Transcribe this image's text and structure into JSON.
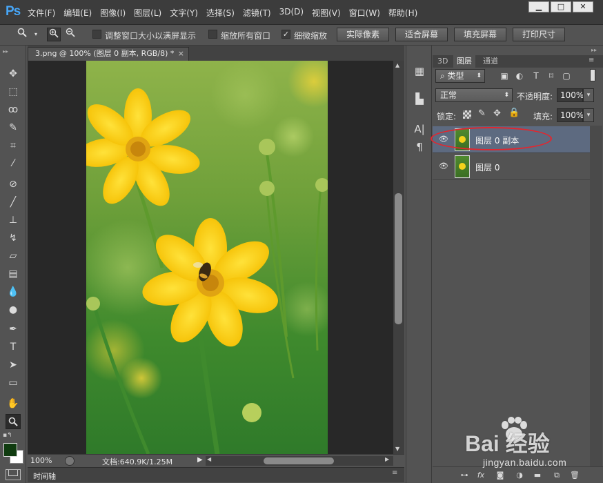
{
  "app": {
    "logo": "Ps",
    "menu": [
      "文件(F)",
      "编辑(E)",
      "图像(I)",
      "图层(L)",
      "文字(Y)",
      "选择(S)",
      "滤镜(T)",
      "3D(D)",
      "视图(V)",
      "窗口(W)",
      "帮助(H)"
    ],
    "window_controls": [
      "▁",
      "□",
      "✕"
    ]
  },
  "options": {
    "resize_windows_label": "调整窗口大小以满屏显示",
    "resize_windows_checked": false,
    "zoom_all_label": "缩放所有窗口",
    "zoom_all_checked": false,
    "scrubby_label": "细微缩放",
    "scrubby_checked": true,
    "buttons": [
      "实际像素",
      "适合屏幕",
      "填充屏幕",
      "打印尺寸"
    ]
  },
  "document": {
    "tab_title": "3.png @ 100% (图层 0 副本, RGB/8) *",
    "close_glyph": "×",
    "zoom": "100%",
    "doc_info": "文档:640.9K/1.25M"
  },
  "timeline": {
    "label": "时间轴"
  },
  "panels": {
    "tabs": [
      "3D",
      "图层",
      "通道"
    ],
    "active_tab": "图层",
    "filter_kind": "类型",
    "blend_mode": "正常",
    "opacity_label": "不透明度:",
    "opacity": "100%",
    "lock_label": "锁定:",
    "fill_label": "填充:",
    "fill": "100%",
    "layers": [
      {
        "name": "图层 0 副本",
        "selected": true
      },
      {
        "name": "图层 0",
        "selected": false
      }
    ],
    "footer_icons": [
      "link-icon",
      "fx-icon",
      "mask-icon",
      "adjustment-icon",
      "folder-icon",
      "new-layer-icon",
      "trash-icon"
    ]
  },
  "watermark": {
    "brand": "Bai 经验",
    "url": "jingyan.baidu.com"
  },
  "colors": {
    "accent_blue": "#47a6f7",
    "selected_layer": "#5d6a80",
    "highlight_red": "#e3262e",
    "foreground_swatch": "#0f3b0f",
    "background_swatch": "#ffffff"
  }
}
